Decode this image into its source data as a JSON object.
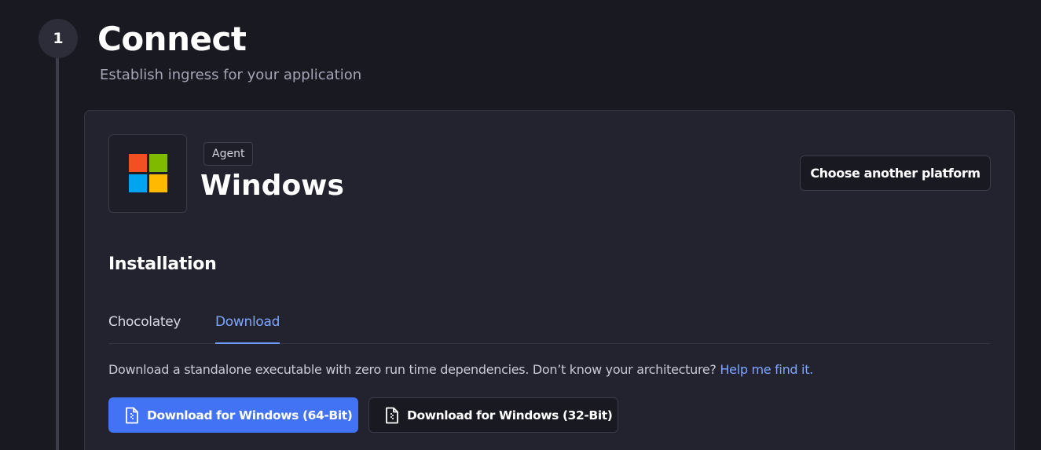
{
  "step": {
    "number": "1",
    "title": "Connect",
    "subtitle": "Establish ingress for your application"
  },
  "platform": {
    "badge": "Agent",
    "name": "Windows",
    "logo_icon": "windows-logo-icon",
    "logo_colors": [
      "#f25022",
      "#7fba00",
      "#00a4ef",
      "#ffb900"
    ],
    "choose_button": "Choose another platform"
  },
  "installation": {
    "title": "Installation",
    "tabs": [
      {
        "label": "Chocolatey",
        "active": false
      },
      {
        "label": "Download",
        "active": true
      }
    ],
    "description": "Download a standalone executable with zero run time dependencies. Don’t know your architecture?",
    "help_link": "Help me find it.",
    "buttons": [
      {
        "label": "Download for Windows (64-Bit)",
        "icon": "file-zip-icon"
      },
      {
        "label": "Download for Windows (32-Bit)",
        "icon": "file-zip-icon"
      }
    ]
  },
  "colors": {
    "accent": "#4373f5",
    "link": "#7ea6ff",
    "background": "#191922",
    "card": "#22232f"
  }
}
